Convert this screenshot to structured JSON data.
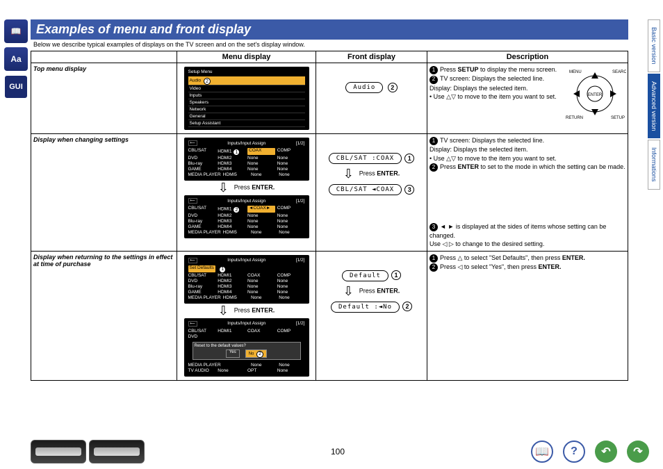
{
  "title": "Examples of menu and front display",
  "intro": "Below we describe typical examples of displays on the TV screen and on the set's display window.",
  "headers": {
    "col1": "Menu display",
    "col2": "Front display",
    "col3": "Description"
  },
  "rows": {
    "top": {
      "label": "Top menu display",
      "lcd": "Audio",
      "lcd_n": "2",
      "desc1": "Press ",
      "desc1b": "SETUP",
      "desc1c": " to display the menu screen.",
      "desc2": "TV screen: Displays the selected line.\nDisplay: Displays the selected item.\n• Use △▽ to move to the item you want to set.",
      "tv": {
        "title": "Setup Menu",
        "items": [
          "Audio",
          "Video",
          "Inputs",
          "Speakers",
          "Network",
          "General",
          "Setup Assistant"
        ],
        "badge": "2"
      }
    },
    "changing": {
      "label": "Display when changing settings",
      "lcd1": "CBL/SAT :COAX",
      "lcd1_n": "1",
      "lcd2": "CBL/SAT ◄COAX",
      "lcd2_n": "3",
      "press": "Press ",
      "pressb": "ENTER.",
      "desc1": "TV screen: Displays the selected line.\nDisplay: Displays the selected item.\n• Use △▽ to move to the item you want to set.",
      "desc2": "Press ",
      "desc2b": "ENTER",
      "desc2c": " to set to the mode in which the setting can be made.",
      "desc3": "◄ ► is displayed at the sides of items whose setting can be changed.\nUse ◁ ▷ to change to the desired setting.",
      "tv1": {
        "title": "Inputs/Input Assign",
        "page": "[1/2]",
        "back": "⟵",
        "grid": [
          [
            "CBL/SAT",
            "HDMI1",
            "COAX",
            "COMP"
          ],
          [
            "DVD",
            "HDMI2",
            "None",
            "None"
          ],
          [
            "Blu-ray",
            "HDMI3",
            "None",
            "None"
          ],
          [
            "GAME",
            "HDMI4",
            "None",
            "None"
          ],
          [
            "MEDIA PLAYER",
            "HDMI5",
            "None",
            "None"
          ]
        ],
        "badge": "1",
        "hl_cell": "COAX"
      },
      "tv2": {
        "title": "Inputs/Input Assign",
        "page": "[1/2]",
        "back": "⟵",
        "grid": [
          [
            "CBL/SAT",
            "HDMI1",
            "◄COAX►",
            "COMP"
          ],
          [
            "DVD",
            "HDMI2",
            "None",
            "None"
          ],
          [
            "Blu-ray",
            "HDMI3",
            "None",
            "None"
          ],
          [
            "GAME",
            "HDMI4",
            "None",
            "None"
          ],
          [
            "MEDIA PLAYER",
            "HDMI5",
            "None",
            "None"
          ]
        ],
        "badge": "2",
        "hl_cell": "◄COAX►"
      }
    },
    "defaults": {
      "label": "Display when returning to the settings in effect at time of purchase",
      "lcd1": "Default",
      "lcd1_n": "1",
      "lcd2": "Default :◄No",
      "lcd2_n": "2",
      "press": "Press ",
      "pressb": "ENTER.",
      "desc1": "Press △ to select \"Set Defaults\", then press ",
      "desc1b": "ENTER.",
      "desc2": "Press ◁ to select \"Yes\", then press ",
      "desc2b": "ENTER.",
      "tv1": {
        "title": "Inputs/Input Assign",
        "page": "[1/2]",
        "back": "⟵",
        "setdef": "Set Defaults",
        "badge": "1",
        "grid": [
          [
            "CBL/SAT",
            "HDMI1",
            "COAX",
            "COMP"
          ],
          [
            "DVD",
            "HDMI2",
            "None",
            "None"
          ],
          [
            "Blu-ray",
            "HDMI3",
            "None",
            "None"
          ],
          [
            "GAME",
            "HDMI4",
            "None",
            "None"
          ],
          [
            "MEDIA PLAYER",
            "HDMI5",
            "None",
            "None"
          ]
        ]
      },
      "tv2": {
        "title": "Inputs/Input Assign",
        "page": "[1/2]",
        "back": "⟵",
        "dialog": {
          "q": "Reset to the default values?",
          "yes": "Yes",
          "no": "No"
        },
        "badge": "2",
        "grid": [
          [
            "CBL/SAT",
            "HDMI1",
            "COAX",
            "COMP"
          ],
          [
            "DVD",
            "",
            "",
            ""
          ],
          [
            "Blu-ray",
            "",
            "",
            ""
          ],
          [
            "MEDIA PLAYER",
            "",
            "None",
            "None"
          ],
          [
            "TV AUDIO",
            "None",
            "OPT",
            "None"
          ]
        ]
      }
    }
  },
  "tabs": {
    "t1": "Basic version",
    "t2": "Advanced version",
    "t3": "Informations"
  },
  "page": "100",
  "leftIcons": {
    "book": "📖",
    "aa": "Aa",
    "gui": "GUI"
  }
}
